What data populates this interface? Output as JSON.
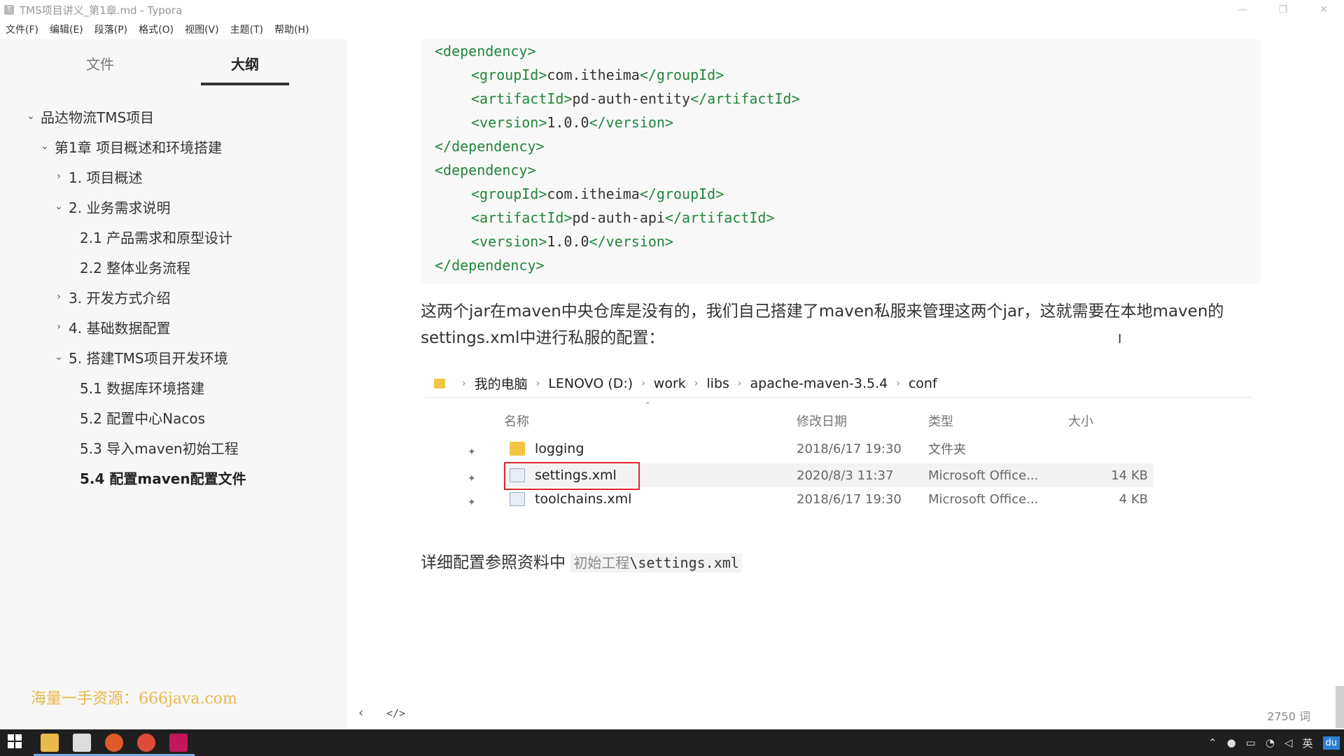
{
  "window": {
    "title": "TMS项目讲义_第1章.md - Typora",
    "controls": [
      "—",
      "❐",
      "✕"
    ]
  },
  "menu": [
    "文件(F)",
    "编辑(E)",
    "段落(P)",
    "格式(O)",
    "视图(V)",
    "主题(T)",
    "帮助(H)"
  ],
  "sidebar": {
    "tabs": {
      "files": "文件",
      "outline": "大纲"
    },
    "outline": [
      {
        "label": "品达物流TMS项目",
        "chevron": "⌄",
        "level": 0
      },
      {
        "label": "第1章 项目概述和环境搭建",
        "chevron": "⌄",
        "level": 1
      },
      {
        "label": "1. 项目概述",
        "chevron": "›",
        "level": 2
      },
      {
        "label": "2. 业务需求说明",
        "chevron": "⌄",
        "level": 2
      },
      {
        "label": "2.1 产品需求和原型设计",
        "chevron": "",
        "level": 3
      },
      {
        "label": "2.2 整体业务流程",
        "chevron": "",
        "level": 3
      },
      {
        "label": "3. 开发方式介绍",
        "chevron": "›",
        "level": 2
      },
      {
        "label": "4. 基础数据配置",
        "chevron": "›",
        "level": 2
      },
      {
        "label": "5. 搭建TMS项目开发环境",
        "chevron": "⌄",
        "level": 2
      },
      {
        "label": "5.1 数据库环境搭建",
        "chevron": "",
        "level": 3
      },
      {
        "label": "5.2 配置中心Nacos",
        "chevron": "",
        "level": 3
      },
      {
        "label": "5.3 导入maven初始工程",
        "chevron": "",
        "level": 3
      },
      {
        "label": "5.4 配置maven配置文件",
        "chevron": "",
        "level": 3,
        "active": true
      }
    ],
    "watermark": "海量一手资源：666java.com"
  },
  "code": [
    {
      "indent": 0,
      "open": "<dependency>",
      "text": "",
      "close": ""
    },
    {
      "indent": 1,
      "open": "<groupId>",
      "text": "com.itheima",
      "close": "</groupId>"
    },
    {
      "indent": 1,
      "open": "<artifactId>",
      "text": "pd-auth-entity",
      "close": "</artifactId>"
    },
    {
      "indent": 1,
      "open": "<version>",
      "text": "1.0.0",
      "close": "</version>"
    },
    {
      "indent": 0,
      "open": "</dependency>",
      "text": "",
      "close": ""
    },
    {
      "indent": 0,
      "open": "<dependency>",
      "text": "",
      "close": ""
    },
    {
      "indent": 1,
      "open": "<groupId>",
      "text": "com.itheima",
      "close": "</groupId>"
    },
    {
      "indent": 1,
      "open": "<artifactId>",
      "text": "pd-auth-api",
      "close": "</artifactId>"
    },
    {
      "indent": 1,
      "open": "<version>",
      "text": "1.0.0",
      "close": "</version>"
    },
    {
      "indent": 0,
      "open": "</dependency>",
      "text": "",
      "close": ""
    }
  ],
  "paragraph": "这两个jar在maven中央仓库是没有的，我们自己搭建了maven私服来管理这两个jar，这就需要在本地maven的settings.xml中进行私服的配置：",
  "explorer": {
    "breadcrumb": [
      "我的电脑",
      "LENOVO (D:)",
      "work",
      "libs",
      "apache-maven-3.5.4",
      "conf"
    ],
    "columns": {
      "name": "名称",
      "date": "修改日期",
      "type": "类型",
      "size": "大小"
    },
    "files": [
      {
        "name": "logging",
        "date": "2018/6/17 19:30",
        "type": "文件夹",
        "size": "",
        "kind": "folder"
      },
      {
        "name": "settings.xml",
        "date": "2020/8/3 11:37",
        "type": "Microsoft Office...",
        "size": "14 KB",
        "kind": "doc",
        "selected": true
      },
      {
        "name": "toolchains.xml",
        "date": "2018/6/17 19:30",
        "type": "Microsoft Office...",
        "size": "4 KB",
        "kind": "doc"
      }
    ]
  },
  "detail": {
    "prefix": "详细配置参照资料中 ",
    "path_cn": "初始工程",
    "path_file": "\\settings.xml"
  },
  "status": {
    "back": "‹",
    "source": "</>",
    "wordcount": "2750 词"
  },
  "tray": {
    "ime": "英",
    "app": "du"
  }
}
